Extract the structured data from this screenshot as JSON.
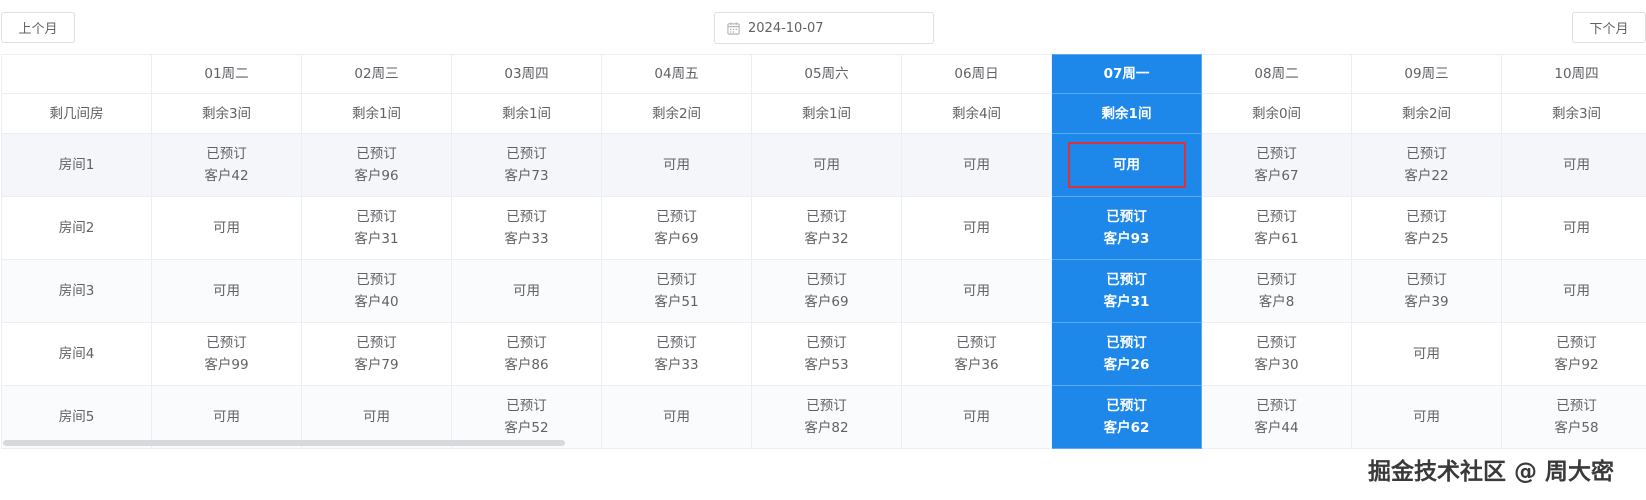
{
  "nav": {
    "prev_label": "上个月",
    "next_label": "下个月"
  },
  "date_picker": {
    "value": "2024-10-07"
  },
  "corner_label": "剩几间房",
  "days": [
    {
      "label": "01周二",
      "remain": "剩余3间"
    },
    {
      "label": "02周三",
      "remain": "剩余1间"
    },
    {
      "label": "03周四",
      "remain": "剩余1间"
    },
    {
      "label": "04周五",
      "remain": "剩余2间"
    },
    {
      "label": "05周六",
      "remain": "剩余1间"
    },
    {
      "label": "06周日",
      "remain": "剩余4间"
    },
    {
      "label": "07周一",
      "remain": "剩余1间"
    },
    {
      "label": "08周二",
      "remain": "剩余0间"
    },
    {
      "label": "09周三",
      "remain": "剩余2间"
    },
    {
      "label": "10周四",
      "remain": "剩余3间"
    }
  ],
  "selected_index": 6,
  "rooms": [
    {
      "name": "房间1",
      "cells": [
        {
          "status": "已预订",
          "customer": "客户42"
        },
        {
          "status": "已预订",
          "customer": "客户96"
        },
        {
          "status": "已预订",
          "customer": "客户73"
        },
        {
          "status": "可用"
        },
        {
          "status": "可用"
        },
        {
          "status": "可用"
        },
        {
          "status": "可用",
          "highlighted": true
        },
        {
          "status": "已预订",
          "customer": "客户67"
        },
        {
          "status": "已预订",
          "customer": "客户22"
        },
        {
          "status": "可用"
        }
      ]
    },
    {
      "name": "房间2",
      "cells": [
        {
          "status": "可用"
        },
        {
          "status": "已预订",
          "customer": "客户31"
        },
        {
          "status": "已预订",
          "customer": "客户33"
        },
        {
          "status": "已预订",
          "customer": "客户69"
        },
        {
          "status": "已预订",
          "customer": "客户32"
        },
        {
          "status": "可用"
        },
        {
          "status": "已预订",
          "customer": "客户93"
        },
        {
          "status": "已预订",
          "customer": "客户61"
        },
        {
          "status": "已预订",
          "customer": "客户25"
        },
        {
          "status": "可用"
        }
      ]
    },
    {
      "name": "房间3",
      "cells": [
        {
          "status": "可用"
        },
        {
          "status": "已预订",
          "customer": "客户40"
        },
        {
          "status": "可用"
        },
        {
          "status": "已预订",
          "customer": "客户51"
        },
        {
          "status": "已预订",
          "customer": "客户69"
        },
        {
          "status": "可用"
        },
        {
          "status": "已预订",
          "customer": "客户31"
        },
        {
          "status": "已预订",
          "customer": "客户8"
        },
        {
          "status": "已预订",
          "customer": "客户39"
        },
        {
          "status": "可用"
        }
      ]
    },
    {
      "name": "房间4",
      "cells": [
        {
          "status": "已预订",
          "customer": "客户99"
        },
        {
          "status": "已预订",
          "customer": "客户79"
        },
        {
          "status": "已预订",
          "customer": "客户86"
        },
        {
          "status": "已预订",
          "customer": "客户33"
        },
        {
          "status": "已预订",
          "customer": "客户53"
        },
        {
          "status": "已预订",
          "customer": "客户36"
        },
        {
          "status": "已预订",
          "customer": "客户26"
        },
        {
          "status": "已预订",
          "customer": "客户30"
        },
        {
          "status": "可用"
        },
        {
          "status": "已预订",
          "customer": "客户92"
        }
      ]
    },
    {
      "name": "房间5",
      "cells": [
        {
          "status": "可用"
        },
        {
          "status": "可用"
        },
        {
          "status": "已预订",
          "customer": "客户52"
        },
        {
          "status": "可用"
        },
        {
          "status": "已预订",
          "customer": "客户82"
        },
        {
          "status": "可用"
        },
        {
          "status": "已预订",
          "customer": "客户62"
        },
        {
          "status": "已预订",
          "customer": "客户44"
        },
        {
          "status": "可用"
        },
        {
          "status": "已预订",
          "customer": "客户58"
        }
      ]
    }
  ],
  "watermark": "掘金技术社区 @ 周大密",
  "colors": {
    "selected_column": "#1e88ea",
    "highlight_border": "#d9343b"
  }
}
